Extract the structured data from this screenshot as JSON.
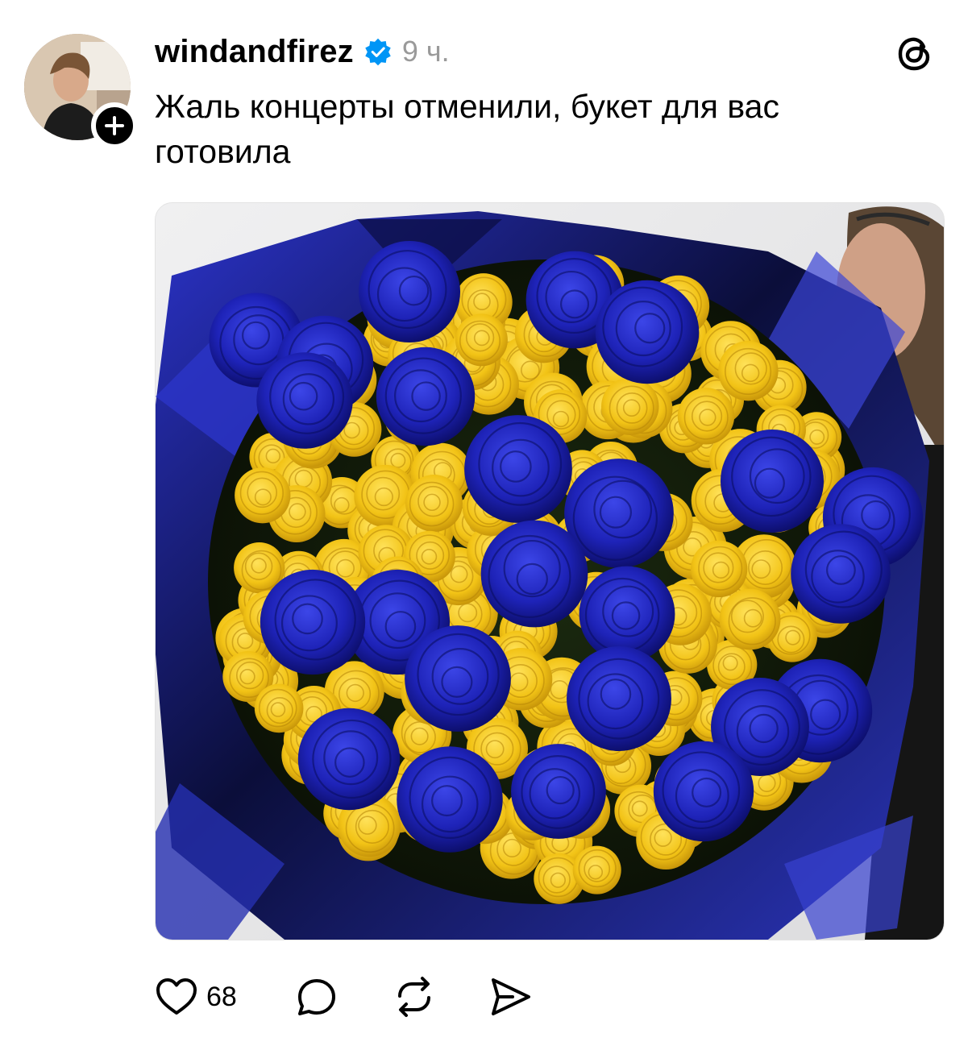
{
  "post": {
    "username": "windandfirez",
    "timestamp": "9 ч.",
    "caption": "Жаль концерты отменили, букет для вас готовила",
    "likes": "68"
  },
  "icons": {
    "verified": "verified-badge-icon",
    "follow": "plus-icon",
    "app": "threads-logo-icon",
    "like": "heart-icon",
    "comment": "comment-bubble-icon",
    "repost": "repost-icon",
    "share": "send-icon"
  },
  "colors": {
    "verified_blue": "#0095f6",
    "timestamp_gray": "#9a9a9a",
    "rose_blue": "#1c1fb4",
    "rose_yellow": "#f2c316",
    "wrap_navy": "#0f1350"
  }
}
